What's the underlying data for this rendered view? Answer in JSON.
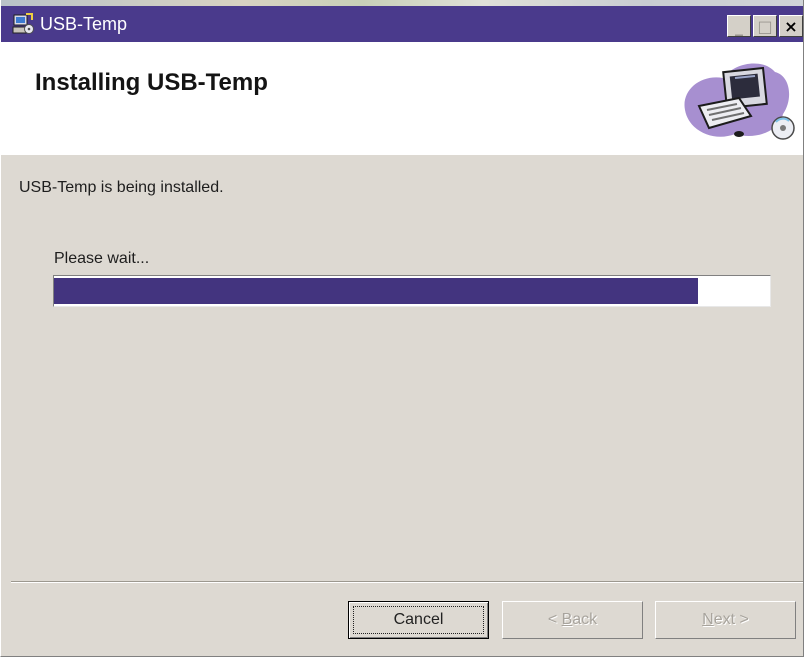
{
  "window": {
    "title": "USB-Temp",
    "icon": "installer-icon",
    "controls": {
      "minimize": "_",
      "maximize": "□",
      "close": "×"
    }
  },
  "header": {
    "title": "Installing USB-Temp",
    "graphic": "computer-cd-icon"
  },
  "body": {
    "status": "USB-Temp is being installed.",
    "wait_label": "Please wait...",
    "progress_percent": 90
  },
  "buttons": {
    "cancel": "Cancel",
    "back": {
      "prefix": "< ",
      "mnemonic": "B",
      "rest": "ack"
    },
    "next": {
      "mnemonic": "N",
      "rest": "ext",
      "suffix": " >"
    }
  },
  "colors": {
    "titlebar": "#4a3a8c",
    "progress_fill": "#43347f",
    "window_bg": "#ddd9d2"
  }
}
